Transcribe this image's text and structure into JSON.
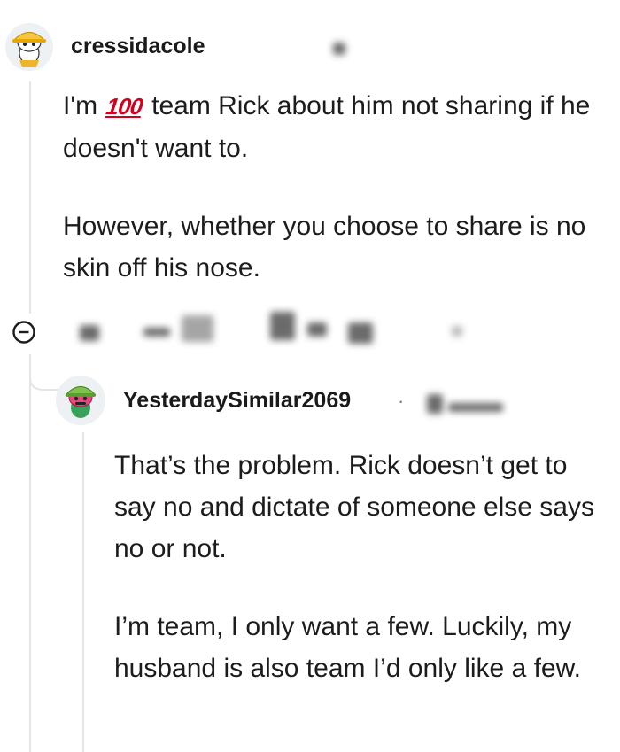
{
  "comment1": {
    "username": "cressidacole",
    "avatar_icon": "snoo-avatar-yellow-hat-icon",
    "paragraph1_before": "I'm ",
    "paragraph1_emoji": "💯",
    "paragraph1_after": " team Rick about him not sharing if he doesn't want to.",
    "paragraph2": "However, whether you choose to share is no skin off his nose."
  },
  "comment2": {
    "username": "YesterdaySimilar2069",
    "separator": "·",
    "avatar_icon": "snoo-avatar-pink-green-hat-icon",
    "paragraph1": "That’s the problem. Rick doesn’t get to say no and dictate of someone else says no or not.",
    "paragraph2": "I’m team, I only want a few. Luckily, my husband is also team I’d only like a few."
  },
  "colors": {
    "thread_line": "#e3e5e8",
    "text": "#1c1c1c",
    "emoji_red": "#d1001f"
  }
}
